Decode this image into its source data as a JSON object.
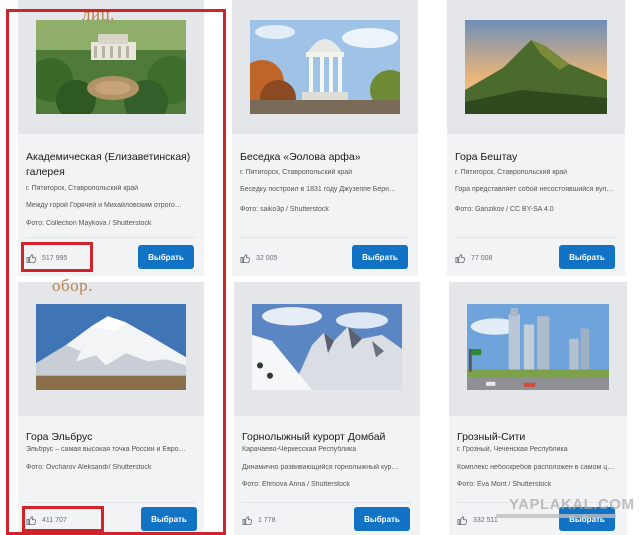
{
  "annotations": {
    "face": "лиц.",
    "back": "обор."
  },
  "watermark": "YAPLAKAL.COM",
  "cards": [
    {
      "title": "Академическая (Елизаветинская) галерея",
      "region": "г. Пятигорск, Ставропольский край",
      "desc": "Между горой Горячей и Михайловским отрого…",
      "photo": "Фото: Collection Maykova / Shutterstock",
      "likes": "517 995",
      "button": "Выбрать",
      "icon": "thumbs-up-icon"
    },
    {
      "title": "Беседка «Эолова арфа»",
      "region": "г. Пятигорск, Ставропольский край",
      "desc": "Беседку построил в 1831 году Джузеппе Берн…",
      "photo": "Фото: saiko3p / Shutterstock",
      "likes": "32 005",
      "button": "Выбрать",
      "icon": "thumbs-up-icon"
    },
    {
      "title": "Гора Бештау",
      "region": "г. Пятигорск, Ставропольский край",
      "desc": "Гора представляет собой несостоявшийся вул…",
      "photo": "Фото: Ganzikov / CC BY-SA 4.0",
      "likes": "77 008",
      "button": "Выбрать",
      "icon": "thumbs-up-icon"
    },
    {
      "title": "Гора Эльбрус",
      "region": "Эльбрус – самая высокая точка России и Евро…",
      "desc": "",
      "photo": "Фото: Ovcharov Aleksandr/ Shutterstock",
      "likes": "411 707",
      "button": "Выбрать",
      "icon": "thumbs-up-icon"
    },
    {
      "title": "Горнолыжный курорт Домбай",
      "region": "Карачаево-Черкесская Республика",
      "desc": "Динамично развивающийся горнолыжный кур…",
      "photo": "Фото: Efimova Anna / Shutterstock",
      "likes": "1 778",
      "button": "Выбрать",
      "icon": "thumbs-up-icon"
    },
    {
      "title": "Грозный-Сити",
      "region": "г. Грозный, Чеченская Республика",
      "desc": "Комплекс небоскребов расположен в самом ц…",
      "photo": "Фото: Eva Mont / Shutterstock",
      "likes": "332 511",
      "button": "Выбрать",
      "icon": "thumbs-up-icon"
    }
  ],
  "colors": {
    "button": "#1273c5",
    "highlight": "#d0232b",
    "annotation": "#b8834e"
  }
}
